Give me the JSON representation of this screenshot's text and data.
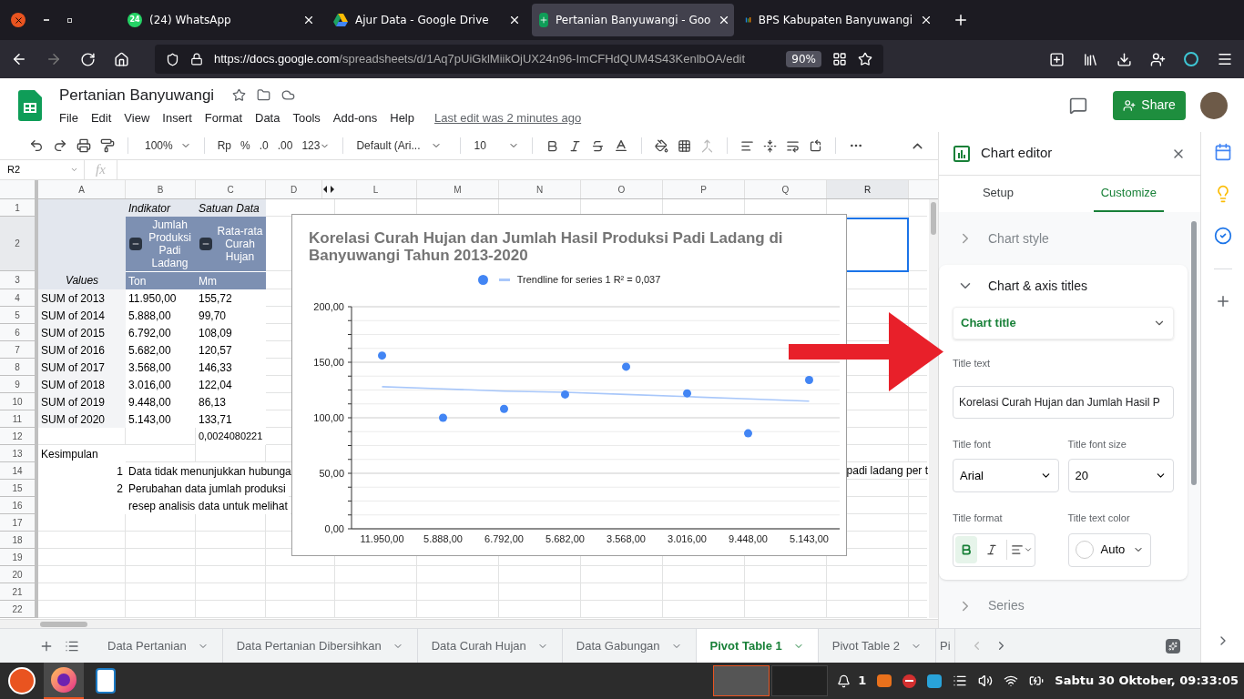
{
  "browser": {
    "tabs": [
      {
        "title": "(24) WhatsApp",
        "badge": "24",
        "selected": false
      },
      {
        "title": "Ajur Data - Google Drive",
        "selected": false
      },
      {
        "title": "Pertanian Banyuwangi - Goo",
        "selected": true
      },
      {
        "title": "BPS Kabupaten Banyuwangi",
        "selected": false
      }
    ],
    "url_host": "https://docs.google.com",
    "url_path": "/spreadsheets/d/1Aq7pUiGklMiikOjUX24n96-ImCFHdQUM4S43KenlbOA/edit",
    "zoom": "90%"
  },
  "doc": {
    "title": "Pertanian Banyuwangi",
    "menu": [
      "File",
      "Edit",
      "View",
      "Insert",
      "Format",
      "Data",
      "Tools",
      "Add-ons",
      "Help"
    ],
    "last_edit": "Last edit was 2 minutes ago",
    "share": "Share"
  },
  "toolbar": {
    "zoom": "100%",
    "currency": "Rp",
    "percent": "%",
    "decrease_decimal": ".0",
    "increase_decimal": ".00",
    "number_format": "123",
    "font": "Default (Ari...",
    "font_size": "10"
  },
  "formula_bar": {
    "cell_ref": "R2",
    "fx": "fx"
  },
  "grid": {
    "columns": [
      {
        "label": "A",
        "selected": false
      },
      {
        "label": "B",
        "selected": false
      },
      {
        "label": "C",
        "selected": false
      },
      {
        "label": "D",
        "selected": false
      },
      {
        "label": "L",
        "selected": false
      },
      {
        "label": "M",
        "selected": false
      },
      {
        "label": "N",
        "selected": false
      },
      {
        "label": "O",
        "selected": false
      },
      {
        "label": "P",
        "selected": false
      },
      {
        "label": "Q",
        "selected": false
      },
      {
        "label": "R",
        "selected": true
      }
    ],
    "rows": [
      {
        "number": "1",
        "selected": false,
        "kind": "pivot-top",
        "cells": [
          "",
          "Indikator",
          "Satuan Data"
        ]
      },
      {
        "number": "2",
        "selected": true,
        "kind": "pivot-header",
        "cells": [
          "",
          "Jumlah Produksi Padi Ladang",
          "Rata-rata Curah Hujan"
        ]
      },
      {
        "number": "3",
        "selected": false,
        "kind": "pivot-units",
        "cells": [
          "Values",
          "Ton",
          "Mm"
        ]
      },
      {
        "number": "4",
        "selected": false,
        "kind": "pivot-data",
        "cells": [
          "SUM of 2013",
          "11.950,00",
          "155,72"
        ]
      },
      {
        "number": "5",
        "selected": false,
        "kind": "pivot-data",
        "cells": [
          "SUM of 2014",
          "5.888,00",
          "99,70"
        ]
      },
      {
        "number": "6",
        "selected": false,
        "kind": "pivot-data",
        "cells": [
          "SUM of 2015",
          "6.792,00",
          "108,09"
        ]
      },
      {
        "number": "7",
        "selected": false,
        "kind": "pivot-data",
        "cells": [
          "SUM of 2016",
          "5.682,00",
          "120,57"
        ]
      },
      {
        "number": "8",
        "selected": false,
        "kind": "pivot-data",
        "cells": [
          "SUM of 2017",
          "3.568,00",
          "146,33"
        ]
      },
      {
        "number": "9",
        "selected": false,
        "kind": "pivot-data",
        "cells": [
          "SUM of 2018",
          "3.016,00",
          "122,04"
        ]
      },
      {
        "number": "10",
        "selected": false,
        "kind": "pivot-data",
        "cells": [
          "SUM of 2019",
          "9.448,00",
          "86,13"
        ]
      },
      {
        "number": "11",
        "selected": false,
        "kind": "pivot-data",
        "cells": [
          "SUM of 2020",
          "5.143,00",
          "133,71"
        ]
      },
      {
        "number": "12",
        "selected": false,
        "kind": "plain",
        "cells": [
          "",
          "",
          "0,0024080221"
        ]
      },
      {
        "number": "13",
        "selected": false,
        "kind": "plain",
        "cells": [
          "Kesimpulan",
          "",
          ""
        ]
      },
      {
        "number": "14",
        "selected": false,
        "kind": "note",
        "cells": [
          "1",
          "Data tidak menunjukkan hubunga",
          ""
        ],
        "tail": "padi ladang per t"
      },
      {
        "number": "15",
        "selected": false,
        "kind": "note",
        "cells": [
          "2",
          "Perubahan data jumlah produksi",
          ""
        ]
      },
      {
        "number": "16",
        "selected": false,
        "kind": "note",
        "cells": [
          "",
          "resep analisis data untuk melihat",
          ""
        ]
      },
      {
        "number": "17",
        "selected": false,
        "kind": "plain",
        "cells": [
          "",
          "",
          ""
        ]
      },
      {
        "number": "18",
        "selected": false,
        "kind": "plain",
        "cells": [
          "",
          "",
          ""
        ]
      },
      {
        "number": "19",
        "selected": false,
        "kind": "plain",
        "cells": [
          "",
          "",
          ""
        ]
      },
      {
        "number": "20",
        "selected": false,
        "kind": "plain",
        "cells": [
          "",
          "",
          ""
        ]
      },
      {
        "number": "21",
        "selected": false,
        "kind": "plain",
        "cells": [
          "",
          "",
          ""
        ]
      },
      {
        "number": "22",
        "selected": false,
        "kind": "plain",
        "cells": [
          "",
          "",
          ""
        ]
      }
    ]
  },
  "chart": {
    "chart_data": {
      "type": "scatter",
      "title": "Korelasi Curah Hujan dan Jumlah Hasil Produksi Padi Ladang di Banyuwangi Tahun 2013-2020",
      "categories": [
        "11.950,00",
        "5.888,00",
        "6.792,00",
        "5.682,00",
        "3.568,00",
        "3.016,00",
        "9.448,00",
        "5.143,00"
      ],
      "series": [
        {
          "color": "#4285f4",
          "values": [
            156,
            100,
            108,
            121,
            146,
            122,
            86,
            134
          ]
        },
        {
          "name": "Trendline for series 1 R² = 0,037",
          "color": "#a8c7fa",
          "type": "line",
          "values": [
            128,
            126,
            124,
            123,
            121,
            119,
            117,
            115
          ]
        }
      ],
      "ylim": [
        0,
        200
      ],
      "grid": true,
      "yticks": [
        {
          "value": 0,
          "label": "0,00"
        },
        {
          "value": 50,
          "label": "50,00"
        },
        {
          "value": 100,
          "label": "100,00"
        },
        {
          "value": 150,
          "label": "150,00"
        },
        {
          "value": 200,
          "label": "200,00"
        }
      ]
    }
  },
  "chart_editor": {
    "title": "Chart editor",
    "tabs": [
      {
        "label": "Setup",
        "selected": false
      },
      {
        "label": "Customize",
        "selected": true
      }
    ],
    "sections": [
      {
        "label": "Chart style",
        "expanded": false
      },
      {
        "label": "Chart & axis titles",
        "expanded": true
      },
      {
        "label": "Series",
        "expanded": false
      }
    ],
    "title_target": "Chart title",
    "title_text_label": "Title text",
    "title_text": "Korelasi Curah Hujan dan Jumlah Hasil P",
    "font_label": "Title font",
    "font": "Arial",
    "size_label": "Title font size",
    "size": "20",
    "format_label": "Title format",
    "bold": true,
    "italic": false,
    "color_label": "Title text color",
    "text_color_choice": "Auto"
  },
  "sheet_tabs": [
    {
      "label": "Data Pertanian",
      "selected": false
    },
    {
      "label": "Data Pertanian Dibersihkan",
      "selected": false
    },
    {
      "label": "Data Curah Hujan",
      "selected": false
    },
    {
      "label": "Data Gabungan",
      "selected": false
    },
    {
      "label": "Pivot Table 1",
      "selected": true
    },
    {
      "label": "Pivot Table 2",
      "selected": false
    },
    {
      "label": "Pi",
      "selected": false
    }
  ],
  "taskbar": {
    "apps": [
      {
        "kind": "ubuntu",
        "selected": false
      },
      {
        "kind": "firefox",
        "selected": true
      },
      {
        "kind": "writer",
        "selected": false
      }
    ],
    "notifications": "1",
    "clock": "Sabtu 30 Oktober, 09:33:05"
  }
}
